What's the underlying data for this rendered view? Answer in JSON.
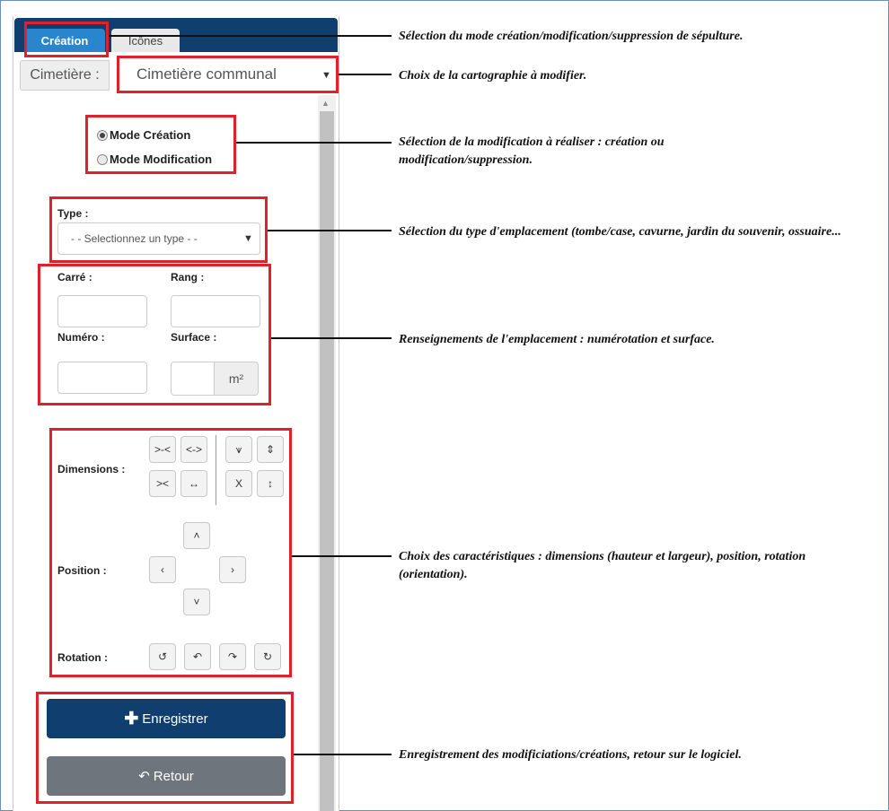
{
  "tabs": [
    {
      "label": "Création",
      "active": true
    },
    {
      "label": "Icônes",
      "active": false
    }
  ],
  "cimetiere": {
    "label": "Cimetière :",
    "value": "Cimetière communal"
  },
  "modes": [
    {
      "label": "Mode Création",
      "selected": true
    },
    {
      "label": "Mode Modification",
      "selected": false
    }
  ],
  "type": {
    "label": "Type :",
    "placeholder": "- - Selectionnez un type - -"
  },
  "fields": {
    "carre": "Carré :",
    "rang": "Rang :",
    "numero": "Numéro :",
    "surface": "Surface :",
    "surface_unit": "m²"
  },
  "controls": {
    "dimensions_label": "Dimensions :",
    "position_label": "Position :",
    "rotation_label": "Rotation :",
    "dim_icons": [
      "shrink-width-fast",
      "expand-width-fast",
      "shrink-height-fast",
      "expand-height-fast",
      "shrink-width",
      "expand-width",
      "shrink-height",
      "expand-height"
    ],
    "rotation_icons": [
      "rotate-left-fast",
      "rotate-left",
      "rotate-right",
      "rotate-right-fast"
    ]
  },
  "buttons": {
    "save": "Enregistrer",
    "back": "Retour"
  },
  "annotations": [
    "Sélection du mode création/modification/suppression de sépulture.",
    "Choix de la cartographie à modifier.",
    "Sélection de la modification à réaliser : création ou modification/suppression.",
    "Sélection du type d'emplacement (tombe/case, cavurne, jardin du souvenir, ossuaire...",
    "Renseignements de l'emplacement : numérotation et surface.",
    "Choix des caractéristiques : dimensions (hauteur et largeur), position, rotation (orientation).",
    "Enregistrement des modificiations/créations, retour sur le logiciel."
  ],
  "colors": {
    "primary": "#0f3e6f",
    "tab_active": "#2a86cc",
    "highlight": "#e0202a",
    "secondary_button": "#6f757c"
  }
}
